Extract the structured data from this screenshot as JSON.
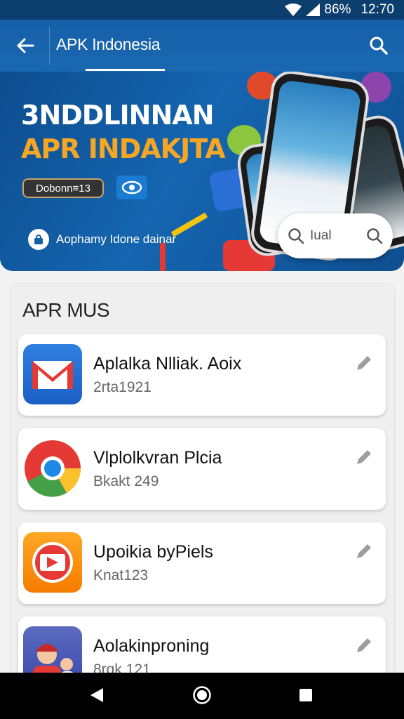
{
  "status_bar": {
    "battery": "86%",
    "time": "12:70"
  },
  "app_bar": {
    "title": "APK Indonesia"
  },
  "banner": {
    "headline_line1": "3NDDLINNAN",
    "headline_line2": "APR INDAKJTA",
    "download_button_label": "Dobonn≡13",
    "note_text": "Aophamy Idone dainar",
    "search_text": "Iual"
  },
  "section": {
    "title": "APR MUS",
    "apps": [
      {
        "name": "Aplalka Nlliak. Aoix",
        "meta": "2rta1921",
        "icon": "mail-icon"
      },
      {
        "name": "Vlplolkvran Plcia",
        "meta": "Bkakt 249",
        "icon": "chrome-icon"
      },
      {
        "name": "Upoikia byPiels",
        "meta": "Knat123",
        "icon": "video-icon"
      },
      {
        "name": "Aolakinproning",
        "meta": "8rqk 121",
        "icon": "people-icon"
      }
    ]
  },
  "colors": {
    "primary": "#1660a8",
    "accent": "#f5a623",
    "status_bar": "#0d3f6e"
  }
}
